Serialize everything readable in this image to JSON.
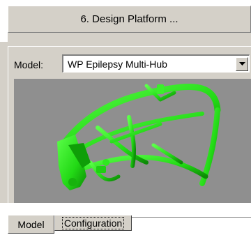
{
  "header": {
    "title": "6.  Design Platform ..."
  },
  "model_selector": {
    "label": "Model:",
    "value": "WP Epilepsy Multi-Hub"
  },
  "tabs": [
    {
      "label": "Model",
      "selected": true
    },
    {
      "label": "Configuration",
      "selected": false
    }
  ],
  "colors": {
    "panel": "#d4d0c8",
    "viewport_bg": "#8f8f8f",
    "model_green": "#2ee81f"
  },
  "icons": {
    "dropdown": "chevron-down-icon"
  }
}
